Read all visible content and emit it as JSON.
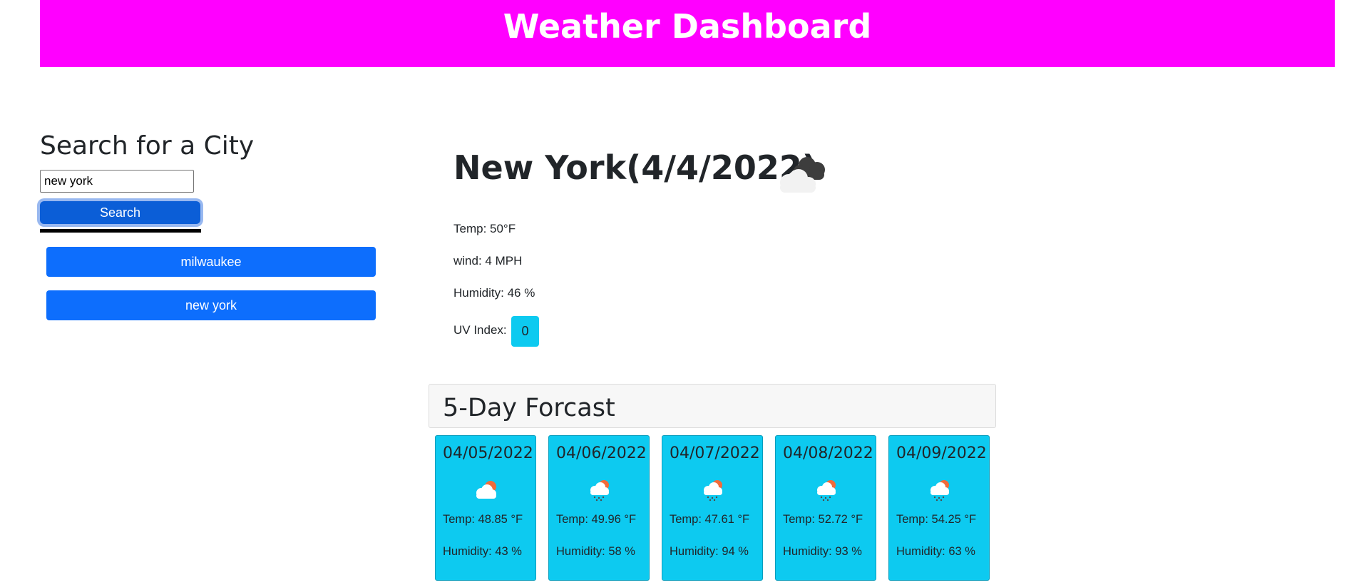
{
  "header": {
    "title": "Weather Dashboard"
  },
  "search": {
    "title": "Search for a City",
    "input_value": "new york",
    "button_label": "Search"
  },
  "history": [
    {
      "label": "milwaukee"
    },
    {
      "label": "new york"
    }
  ],
  "current": {
    "title": "New York(4/4/2022)",
    "icon": "clouds-icon",
    "temp": "Temp: 50°F",
    "wind": "wind: 4 MPH",
    "humidity": "Humidity: 46 %",
    "uv_label": "UV Index:",
    "uv_value": "0"
  },
  "forecast": {
    "title": "5-Day Forcast",
    "days": [
      {
        "date": "04/05/2022",
        "icon": "partly-cloudy-icon",
        "temp": "Temp: 48.85 °F",
        "humidity": "Humidity: 43 %"
      },
      {
        "date": "04/06/2022",
        "icon": "rain-sun-icon",
        "temp": "Temp: 49.96 °F",
        "humidity": "Humidity: 58 %"
      },
      {
        "date": "04/07/2022",
        "icon": "rain-sun-icon",
        "temp": "Temp: 47.61 °F",
        "humidity": "Humidity: 94 %"
      },
      {
        "date": "04/08/2022",
        "icon": "rain-sun-icon",
        "temp": "Temp: 52.72 °F",
        "humidity": "Humidity: 93 %"
      },
      {
        "date": "04/09/2022",
        "icon": "rain-sun-icon",
        "temp": "Temp: 54.25 °F",
        "humidity": "Humidity: 63 %"
      }
    ]
  },
  "colors": {
    "header": "#ff00ff",
    "primary_button": "#0d6efd",
    "search_button": "#0b5ed7",
    "info": "#0dcaf0"
  }
}
